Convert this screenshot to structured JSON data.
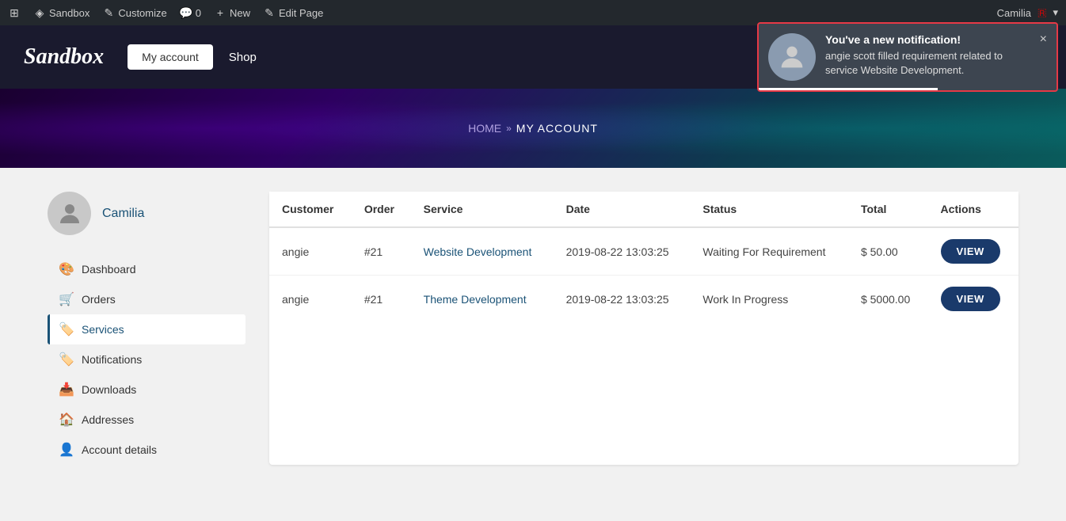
{
  "admin_bar": {
    "wp_icon": "⊞",
    "site_name": "Sandbox",
    "customize_label": "Customize",
    "comments_label": "0",
    "new_label": "New",
    "edit_page_label": "Edit Page",
    "user_name": "Camilia"
  },
  "notification": {
    "title": "You've a new notification!",
    "message": "angie scott filled requirement related to service Website Development.",
    "close_label": "×"
  },
  "header": {
    "logo": "Sandbox",
    "my_account_label": "My account",
    "shop_label": "Shop"
  },
  "breadcrumb": {
    "home": "HOME",
    "separator": "»",
    "current": "MY ACCOUNT"
  },
  "sidebar": {
    "username": "Camilia",
    "nav": [
      {
        "id": "dashboard",
        "label": "Dashboard",
        "icon": "🎨"
      },
      {
        "id": "orders",
        "label": "Orders",
        "icon": "🛒"
      },
      {
        "id": "services",
        "label": "Services",
        "icon": "🏷",
        "active": true
      },
      {
        "id": "notifications",
        "label": "Notifications",
        "icon": "🏷"
      },
      {
        "id": "downloads",
        "label": "Downloads",
        "icon": "📥"
      },
      {
        "id": "addresses",
        "label": "Addresses",
        "icon": "🏠"
      },
      {
        "id": "account-details",
        "label": "Account details",
        "icon": "👤"
      }
    ]
  },
  "table": {
    "columns": [
      "Customer",
      "Order",
      "Service",
      "Date",
      "Status",
      "Total",
      "Actions"
    ],
    "rows": [
      {
        "customer": "angie",
        "order": "#21",
        "service": "Website Development",
        "date": "2019-08-22 13:03:25",
        "status": "Waiting For Requirement",
        "total": "$ 50.00",
        "action": "VIEW"
      },
      {
        "customer": "angie",
        "order": "#21",
        "service": "Theme Development",
        "date": "2019-08-22 13:03:25",
        "status": "Work In Progress",
        "total": "$ 5000.00",
        "action": "VIEW"
      }
    ]
  }
}
